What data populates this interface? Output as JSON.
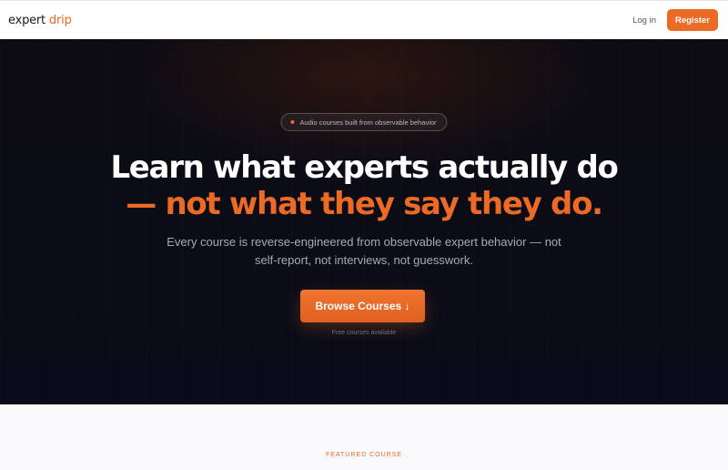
{
  "nav": {
    "logo_primary": "expert",
    "logo_accent": "drip",
    "login_label": "Log in",
    "register_label": "Register"
  },
  "hero": {
    "badge_text": "Audio courses built from observable behavior",
    "title_line1": "Learn what experts actually do",
    "title_line2": "— not what they say they do.",
    "subtitle": "Every course is reverse-engineered from observable expert behavior — not self-report, not interviews, not guesswork.",
    "cta_label": "Browse Courses ↓",
    "cta_note": "Free courses available"
  },
  "featured": {
    "section_label": "FEATURED COURSE"
  },
  "colors": {
    "accent": "#ea6a26",
    "hero_background": "#0b0c18",
    "section_background": "#f9f9fc"
  }
}
